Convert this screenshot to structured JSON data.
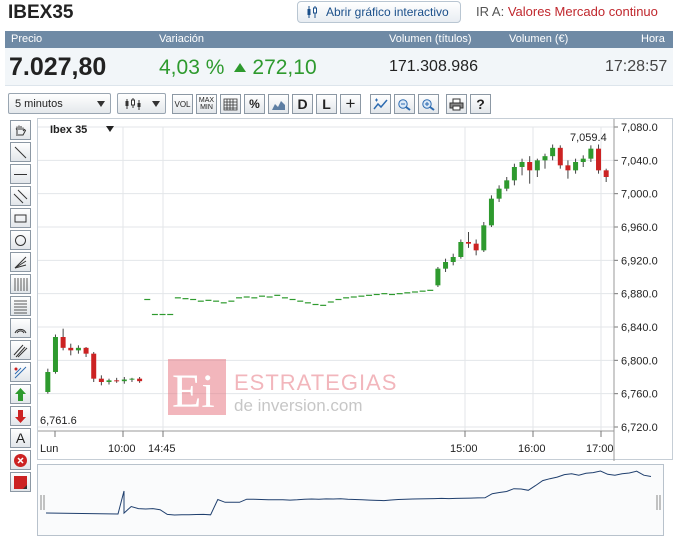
{
  "header": {
    "title": "IBEX35",
    "open_interactive": "Abrir gráfico interactivo",
    "goto_label": "IR A:",
    "goto_link": "Valores Mercado continuo"
  },
  "quote": {
    "labels": {
      "price": "Precio",
      "change": "Variación",
      "volume_titles": "Volumen (títulos)",
      "volume_eur": "Volumen (€)",
      "time": "Hora"
    },
    "price": "7.027,80",
    "change_pct": "4,03 %",
    "change_abs": "272,10",
    "volume_titles": "171.308.986",
    "volume_eur": "",
    "time": "17:28:57"
  },
  "toolbar": {
    "interval": "5 minutos",
    "buttons": {
      "vol": "VOL",
      "maxmin": "MAX MIN",
      "pct": "%",
      "d": "D",
      "l": "L",
      "plus": "+",
      "help": "?"
    }
  },
  "lefttools": {
    "text_tool": "A"
  },
  "watermark": {
    "line1": "ESTRATEGIAS",
    "line2": "de inversion.com",
    "logo": "Ei"
  },
  "colors": {
    "up": "#2e9a2e",
    "down": "#cc2222",
    "header_bg": "#6f8aa5",
    "link": "#c0272d"
  },
  "chart_data": {
    "type": "candlestick",
    "title": "Ibex 35",
    "ylim": [
      6720,
      7080
    ],
    "y_ticks": [
      "7,080.0",
      "7,040.0",
      "7,000.0",
      "6,960.0",
      "6,920.0",
      "6,880.0",
      "6,840.0",
      "6,800.0",
      "6,760.0",
      "6,720.0"
    ],
    "x_labels": [
      "Lun",
      "10:00",
      "14:45",
      "15:00",
      "16:00",
      "17:00"
    ],
    "max_label": "7,059.4",
    "min_label": "6,761.6",
    "candles": [
      [
        6762,
        6790,
        6760,
        6786
      ],
      [
        6786,
        6831,
        6784,
        6828
      ],
      [
        6828,
        6838,
        6812,
        6815
      ],
      [
        6815,
        6820,
        6806,
        6812
      ],
      [
        6812,
        6818,
        6808,
        6815
      ],
      [
        6815,
        6816,
        6804,
        6808
      ],
      [
        6808,
        6810,
        6774,
        6778
      ],
      [
        6778,
        6782,
        6770,
        6774
      ],
      [
        6774,
        6778,
        6771,
        6776
      ],
      [
        6776,
        6779,
        6773,
        6775
      ],
      [
        6775,
        6780,
        6772,
        6777
      ],
      [
        6777,
        6779,
        6774,
        6778
      ],
      [
        6778,
        6780,
        6773,
        6775
      ],
      [
        6873,
        6873,
        6873,
        6873
      ],
      [
        6855,
        6855,
        6855,
        6855
      ],
      [
        6855,
        6855,
        6855,
        6855
      ],
      [
        6855,
        6855,
        6855,
        6855
      ],
      [
        6875,
        6875,
        6875,
        6875
      ],
      [
        6874,
        6874,
        6874,
        6874
      ],
      [
        6873,
        6873,
        6873,
        6873
      ],
      [
        6871,
        6871,
        6871,
        6871
      ],
      [
        6872,
        6872,
        6872,
        6872
      ],
      [
        6871,
        6871,
        6871,
        6871
      ],
      [
        6869,
        6869,
        6869,
        6869
      ],
      [
        6871,
        6871,
        6871,
        6871
      ],
      [
        6875,
        6875,
        6875,
        6875
      ],
      [
        6876,
        6876,
        6876,
        6876
      ],
      [
        6875,
        6875,
        6875,
        6875
      ],
      [
        6877,
        6877,
        6877,
        6877
      ],
      [
        6876,
        6876,
        6876,
        6876
      ],
      [
        6878,
        6878,
        6878,
        6878
      ],
      [
        6875,
        6875,
        6875,
        6875
      ],
      [
        6873,
        6873,
        6873,
        6873
      ],
      [
        6871,
        6871,
        6871,
        6871
      ],
      [
        6869,
        6869,
        6869,
        6869
      ],
      [
        6867,
        6867,
        6867,
        6867
      ],
      [
        6866,
        6866,
        6866,
        6866
      ],
      [
        6870,
        6870,
        6870,
        6870
      ],
      [
        6873,
        6873,
        6873,
        6873
      ],
      [
        6875,
        6875,
        6875,
        6875
      ],
      [
        6876,
        6876,
        6876,
        6876
      ],
      [
        6877,
        6877,
        6877,
        6877
      ],
      [
        6878,
        6878,
        6878,
        6878
      ],
      [
        6879,
        6879,
        6879,
        6879
      ],
      [
        6880,
        6880,
        6880,
        6880
      ],
      [
        6879,
        6879,
        6879,
        6879
      ],
      [
        6880,
        6880,
        6880,
        6880
      ],
      [
        6881,
        6881,
        6881,
        6881
      ],
      [
        6882,
        6882,
        6882,
        6882
      ],
      [
        6883,
        6883,
        6883,
        6883
      ],
      [
        6884,
        6884,
        6884,
        6884
      ],
      [
        6890,
        6912,
        6888,
        6910
      ],
      [
        6910,
        6922,
        6906,
        6918
      ],
      [
        6918,
        6928,
        6914,
        6924
      ],
      [
        6924,
        6945,
        6922,
        6942
      ],
      [
        6942,
        6954,
        6935,
        6940
      ],
      [
        6940,
        6945,
        6926,
        6932
      ],
      [
        6932,
        6966,
        6930,
        6962
      ],
      [
        6962,
        6998,
        6960,
        6994
      ],
      [
        6994,
        7010,
        6990,
        7006
      ],
      [
        7006,
        7020,
        7003,
        7016
      ],
      [
        7016,
        7036,
        7010,
        7032
      ],
      [
        7032,
        7042,
        7022,
        7038
      ],
      [
        7038,
        7045,
        7012,
        7028
      ],
      [
        7028,
        7042,
        7020,
        7040
      ],
      [
        7040,
        7048,
        7030,
        7045
      ],
      [
        7045,
        7059,
        7040,
        7055
      ],
      [
        7055,
        7058,
        7030,
        7034
      ],
      [
        7034,
        7040,
        7018,
        7028
      ],
      [
        7028,
        7042,
        7024,
        7038
      ],
      [
        7038,
        7046,
        7032,
        7042
      ],
      [
        7042,
        7058,
        7038,
        7054
      ],
      [
        7054,
        7059,
        7024,
        7028
      ],
      [
        7028,
        7030,
        7014,
        7020
      ]
    ]
  }
}
